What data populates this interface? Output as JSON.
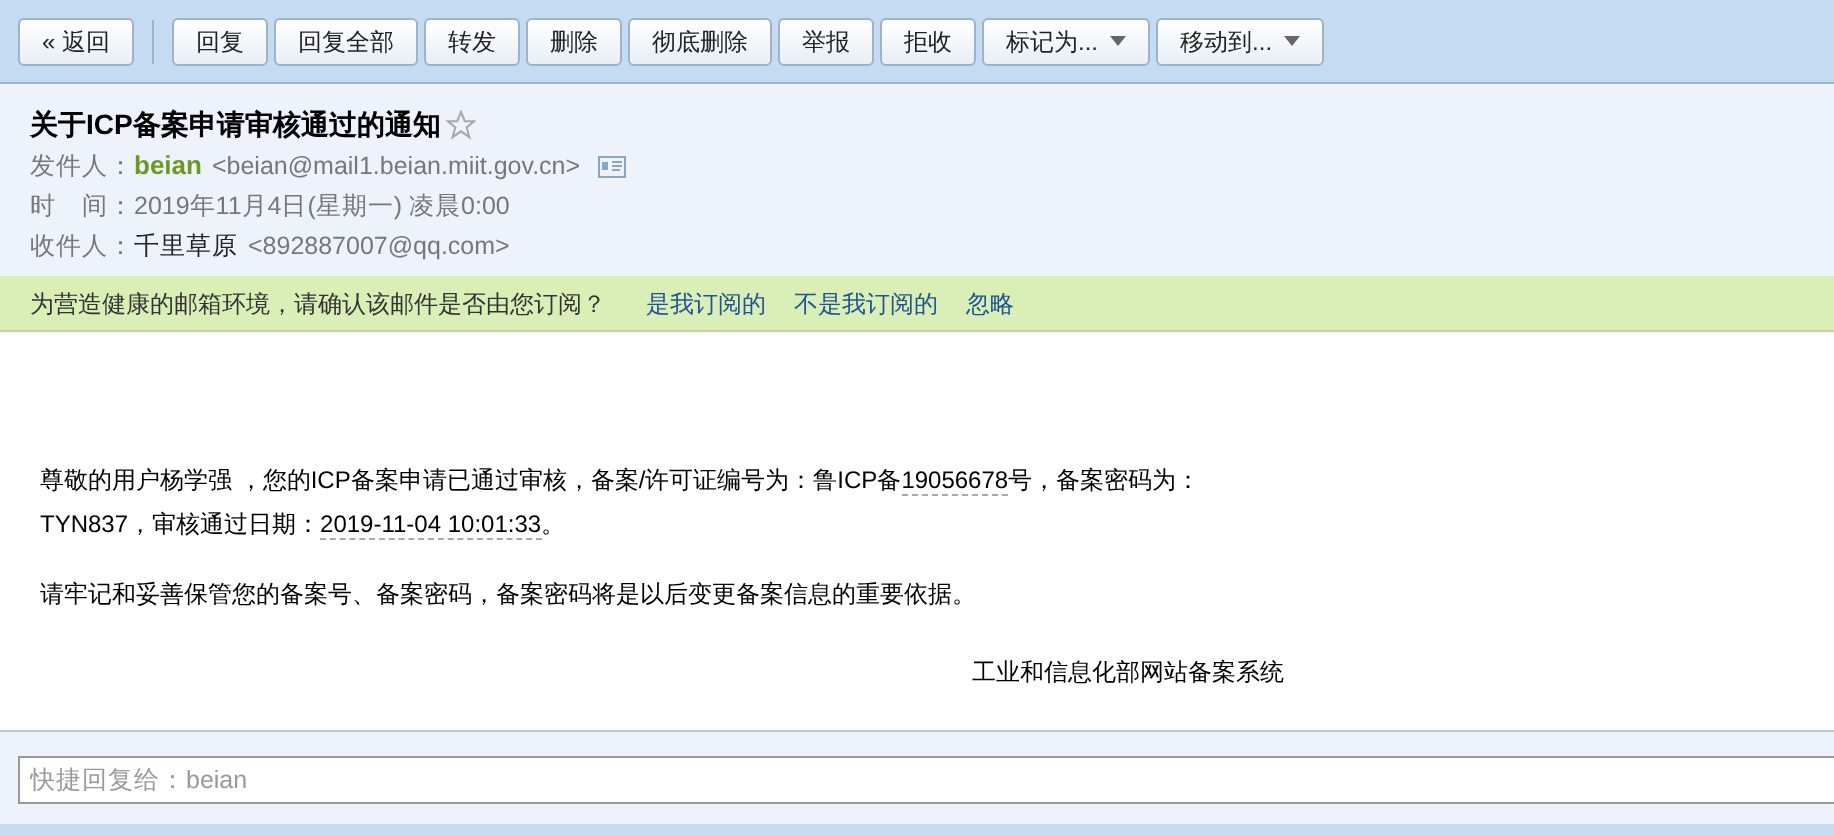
{
  "toolbar": {
    "back": "« 返回",
    "buttons": [
      {
        "label": "回复",
        "kind": "plain"
      },
      {
        "label": "回复全部",
        "kind": "plain"
      },
      {
        "label": "转发",
        "kind": "plain"
      },
      {
        "label": "删除",
        "kind": "plain"
      },
      {
        "label": "彻底删除",
        "kind": "plain"
      },
      {
        "label": "举报",
        "kind": "plain"
      },
      {
        "label": "拒收",
        "kind": "plain"
      },
      {
        "label": "标记为...",
        "kind": "dropdown"
      },
      {
        "label": "移动到...",
        "kind": "dropdown"
      }
    ]
  },
  "header": {
    "subject": "关于ICP备案申请审核通过的通知",
    "starred": false,
    "fields": [
      {
        "label": "发件人：",
        "name": "beian",
        "address": "<beian@mail1.beian.miit.gov.cn>",
        "kind": "sender"
      },
      {
        "label": "时　间：",
        "value": "2019年11月4日(星期一) 凌晨0:00",
        "kind": "time"
      },
      {
        "label": "收件人：",
        "name": "千里草原",
        "address": "<892887007@qq.com>",
        "kind": "recipient"
      }
    ]
  },
  "banner": {
    "message": "为营造健康的邮箱环境，请确认该邮件是否由您订阅？",
    "links": [
      "是我订阅的",
      "不是我订阅的",
      "忽略"
    ]
  },
  "body": {
    "paragraphs": [
      [
        {
          "text": "尊敬的用户杨学强 ，您的ICP备案申请已通过审核，备案/许可证编号为：鲁ICP备",
          "kind": "plain"
        },
        {
          "text": "19056678",
          "kind": "detected"
        },
        {
          "text": "号，备案密码为：TYN837，审核通过日期：",
          "kind": "plain"
        },
        {
          "text": "2019-11-04 10:01:33",
          "kind": "detected"
        },
        {
          "text": "。",
          "kind": "plain"
        }
      ],
      [
        {
          "text": "请牢记和妥善保管您的备案号、备案密码，备案密码将是以后变更备案信息的重要依据。",
          "kind": "plain"
        }
      ]
    ],
    "signature": "工业和信息化部网站备案系统"
  },
  "quick_reply": {
    "placeholder": "快捷回复给：beian"
  }
}
